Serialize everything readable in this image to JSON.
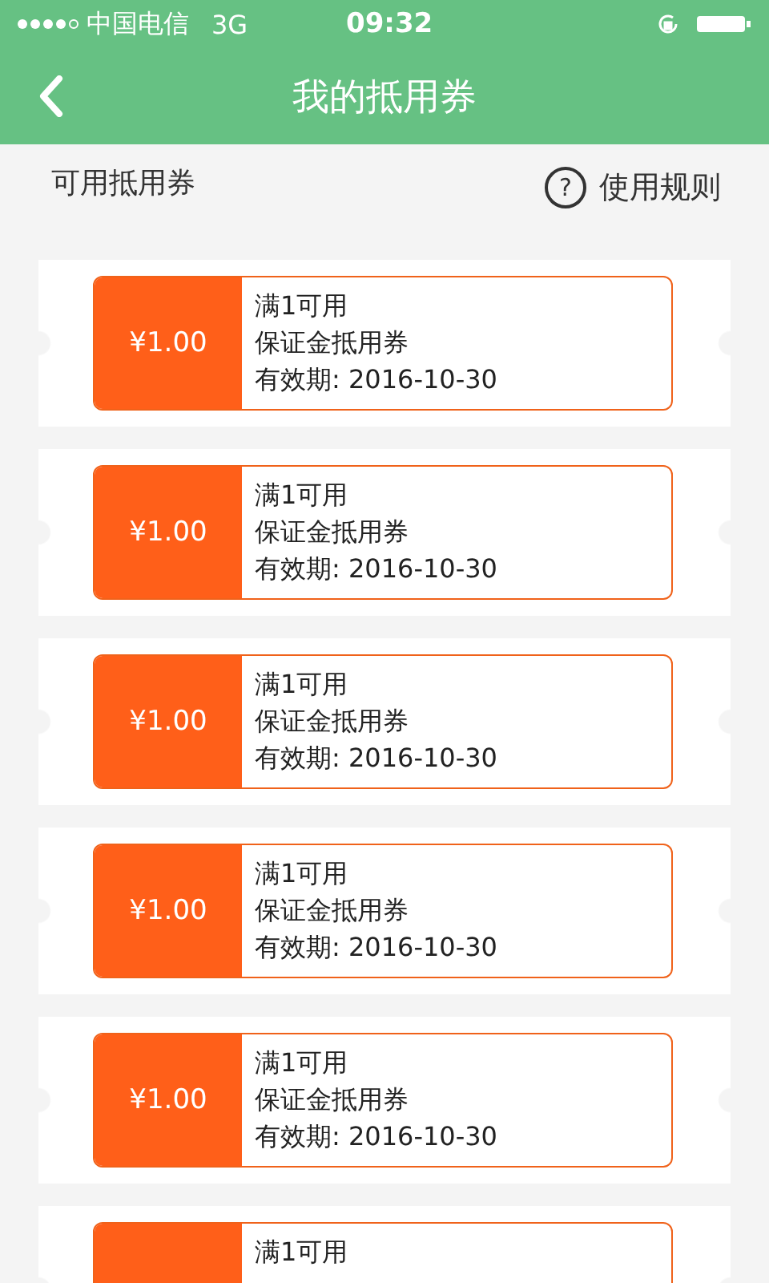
{
  "status_bar": {
    "carrier": "中国电信",
    "network": "3G",
    "time": "09:32"
  },
  "nav": {
    "title": "我的抵用券"
  },
  "section": {
    "title": "可用抵用券",
    "rules": "使用规则",
    "rules_icon": "?"
  },
  "coupons": [
    {
      "amount": "¥1.00",
      "condition": "满1可用",
      "name": "保证金抵用券",
      "validity": "有效期: 2016-10-30"
    },
    {
      "amount": "¥1.00",
      "condition": "满1可用",
      "name": "保证金抵用券",
      "validity": "有效期: 2016-10-30"
    },
    {
      "amount": "¥1.00",
      "condition": "满1可用",
      "name": "保证金抵用券",
      "validity": "有效期: 2016-10-30"
    },
    {
      "amount": "¥1.00",
      "condition": "满1可用",
      "name": "保证金抵用券",
      "validity": "有效期: 2016-10-30"
    },
    {
      "amount": "¥1.00",
      "condition": "满1可用",
      "name": "保证金抵用券",
      "validity": "有效期: 2016-10-30"
    },
    {
      "condition": "满1可用"
    }
  ]
}
